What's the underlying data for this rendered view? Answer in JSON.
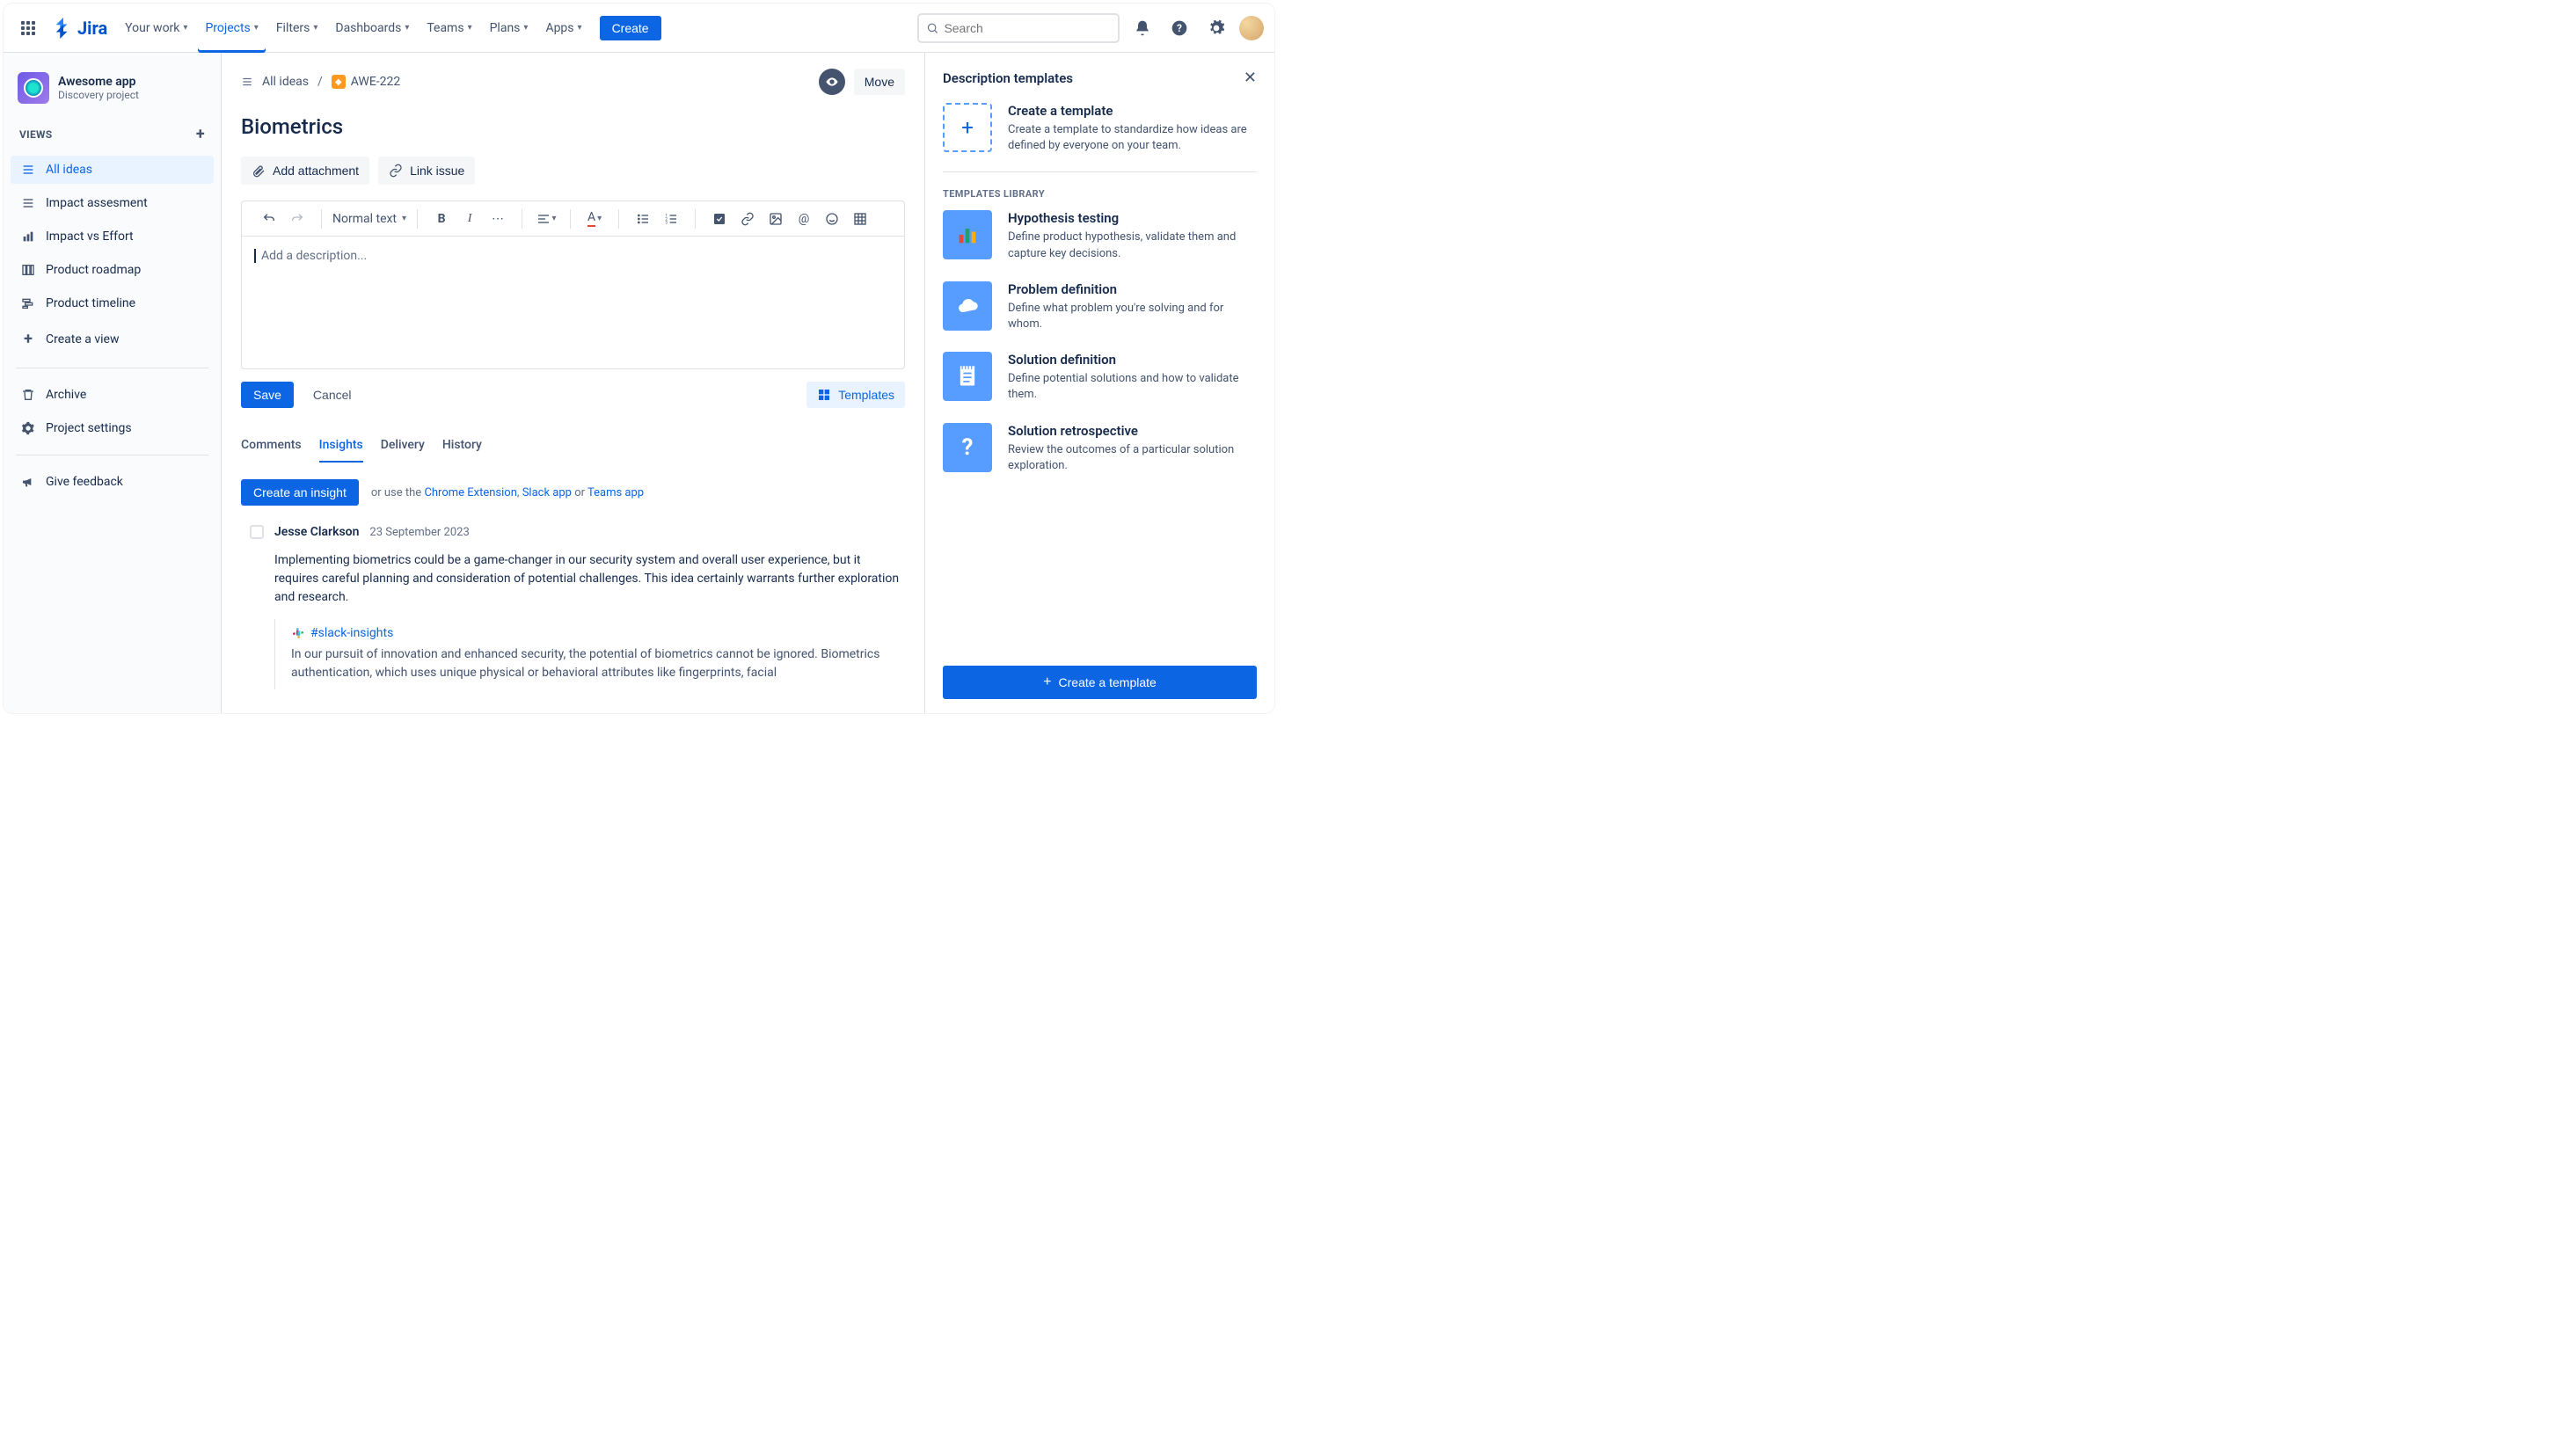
{
  "topnav": {
    "logo": "Jira",
    "items": [
      "Your work",
      "Projects",
      "Filters",
      "Dashboards",
      "Teams",
      "Plans",
      "Apps"
    ],
    "active_index": 1,
    "create": "Create",
    "search_placeholder": "Search"
  },
  "sidebar": {
    "project_name": "Awesome app",
    "project_sub": "Discovery project",
    "section": "VIEWS",
    "views": [
      {
        "label": "All ideas",
        "icon": "list",
        "active": true
      },
      {
        "label": "Impact assesment",
        "icon": "list",
        "active": false
      },
      {
        "label": "Impact vs Effort",
        "icon": "bars",
        "active": false
      },
      {
        "label": "Product roadmap",
        "icon": "columns",
        "active": false
      },
      {
        "label": "Product timeline",
        "icon": "timeline",
        "active": false
      },
      {
        "label": "Create a view",
        "icon": "plus",
        "active": false
      }
    ],
    "archive": "Archive",
    "settings": "Project settings",
    "feedback": "Give feedback"
  },
  "breadcrumb": {
    "all_ideas": "All ideas",
    "issue_key": "AWE-222",
    "move": "Move"
  },
  "issue": {
    "title": "Biometrics",
    "add_attachment": "Add attachment",
    "link_issue": "Link issue"
  },
  "editor": {
    "text_style": "Normal text",
    "placeholder": "Add a description...",
    "save": "Save",
    "cancel": "Cancel",
    "templates": "Templates"
  },
  "tabs": {
    "items": [
      "Comments",
      "Insights",
      "Delivery",
      "History"
    ],
    "active_index": 1
  },
  "insights": {
    "create": "Create an insight",
    "or_use": "or use the",
    "chrome": "Chrome Extension",
    "slack": "Slack app",
    "or": "or",
    "teams": "Teams app",
    "item": {
      "author": "Jesse Clarkson",
      "date": "23 September 2023",
      "body": "Implementing biometrics could be a game-changer in our security system and overall user experience, but it requires careful planning and consideration of potential challenges. This idea certainly warrants further exploration and research.",
      "slack_channel": "#slack-insights",
      "quote": "In our pursuit of innovation and enhanced security, the potential of biometrics cannot be ignored. Biometrics authentication, which uses unique physical or behavioral attributes like fingerprints, facial"
    }
  },
  "rpanel": {
    "title": "Description templates",
    "create_card": {
      "title": "Create a template",
      "desc": "Create a template to standardize how ideas are defined by everyone on your team."
    },
    "library_header": "TEMPLATES LIBRARY",
    "templates": [
      {
        "title": "Hypothesis testing",
        "desc": "Define product hypothesis, validate them and capture key decisions.",
        "icon": "chart"
      },
      {
        "title": "Problem definition",
        "desc": "Define what problem you're solving and for whom.",
        "icon": "cloud"
      },
      {
        "title": "Solution definition",
        "desc": "Define potential solutions and how to validate them.",
        "icon": "notepad"
      },
      {
        "title": "Solution retrospective",
        "desc": "Review the outcomes of a particular solution exploration.",
        "icon": "question"
      }
    ],
    "footer_button": "Create a template"
  }
}
